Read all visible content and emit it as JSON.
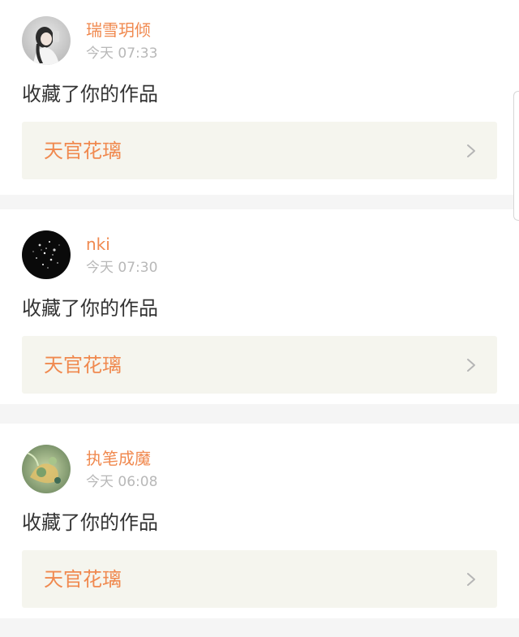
{
  "notifications": [
    {
      "username": "瑞雪玥倾",
      "timestamp": "今天 07:33",
      "action": "收藏了你的作品",
      "work_title": "天官花璃",
      "avatar": "avatar-girl-photo"
    },
    {
      "username": "nki",
      "timestamp": "今天 07:30",
      "action": "收藏了你的作品",
      "work_title": "天官花璃",
      "avatar": "avatar-dark-sparkle"
    },
    {
      "username": "执笔成魔",
      "timestamp": "今天 06:08",
      "action": "收藏了你的作品",
      "work_title": "天官花璃",
      "avatar": "avatar-green-illustration"
    }
  ],
  "colors": {
    "accent": "#f0894f",
    "text": "#333333",
    "muted": "#b8b8b8",
    "link_bg": "#f5f5ee",
    "page_bg": "#f5f5f5"
  }
}
